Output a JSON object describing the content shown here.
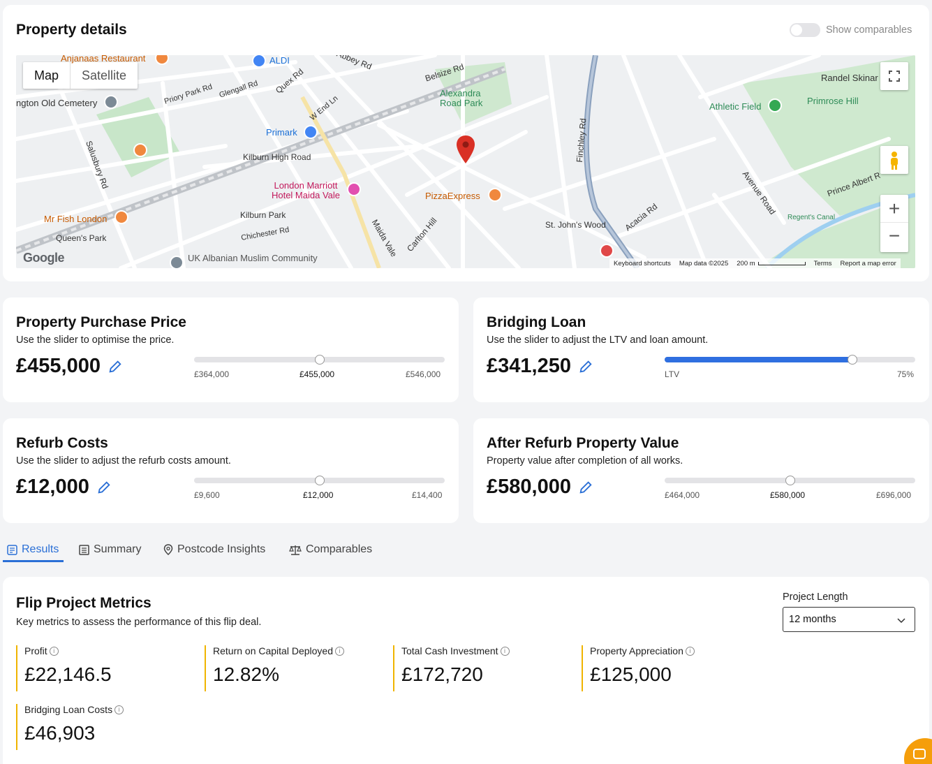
{
  "property": {
    "title": "Property details",
    "show_comparables": "Show comparables",
    "map": {
      "tab_map": "Map",
      "tab_satellite": "Satellite",
      "google": "Google",
      "footer": {
        "keyboard": "Keyboard shortcuts",
        "data": "Map data ©2025",
        "scale": "200 m",
        "terms": "Terms",
        "report": "Report a map error"
      },
      "labels": [
        {
          "text": "Anjanaas Restaurant",
          "color": "#c65a00"
        },
        {
          "text": "ALDI",
          "color": "#1a6fd6"
        },
        {
          "text": "Abbey Rd",
          "color": "#333"
        },
        {
          "text": "Belsize Rd",
          "color": "#333"
        },
        {
          "text": "Alexandra Road Park",
          "color": "#2e8b57"
        },
        {
          "text": "Randel Skinar",
          "color": "#555"
        },
        {
          "text": "Primrose Hill",
          "color": "#2e8b57"
        },
        {
          "text": "Athletic Field",
          "color": "#2e8b57"
        },
        {
          "text": "ngton Old Cemetery",
          "color": "#444"
        },
        {
          "text": "Priory Park Rd",
          "color": "#444"
        },
        {
          "text": "Glengall Rd",
          "color": "#444"
        },
        {
          "text": "Quex Rd",
          "color": "#444"
        },
        {
          "text": "W End Ln",
          "color": "#444"
        },
        {
          "text": "Primark",
          "color": "#1a6fd6"
        },
        {
          "text": "Kilburn High Road",
          "color": "#333"
        },
        {
          "text": "Salusbury Rd",
          "color": "#333"
        },
        {
          "text": "London Marriott Hotel Maida Vale",
          "color": "#c2185b"
        },
        {
          "text": "PizzaExpress",
          "color": "#c65a00"
        },
        {
          "text": "Kilburn Park",
          "color": "#333"
        },
        {
          "text": "Mr Fish London",
          "color": "#c65a00"
        },
        {
          "text": "Queen's Park",
          "color": "#333"
        },
        {
          "text": "Chichester Rd",
          "color": "#444"
        },
        {
          "text": "Maida Vale",
          "color": "#333"
        },
        {
          "text": "Carlton Hill",
          "color": "#333"
        },
        {
          "text": "St. John's Wood",
          "color": "#333"
        },
        {
          "text": "Acacia Rd",
          "color": "#333"
        },
        {
          "text": "Finchley Rd",
          "color": "#333"
        },
        {
          "text": "Avenue Road",
          "color": "#333"
        },
        {
          "text": "Prince Albert R",
          "color": "#333"
        },
        {
          "text": "UK Albanian Muslim Community",
          "color": "#555"
        },
        {
          "text": "Regent's Canal",
          "color": "#2e8b57"
        }
      ]
    }
  },
  "purchase": {
    "title": "Property Purchase Price",
    "subtitle": "Use the slider to optimise the price.",
    "value": "£455,000",
    "min_label": "£364,000",
    "mid_label": "£455,000",
    "max_label": "£546,000",
    "slider_fraction": 0.5
  },
  "bridging": {
    "title": "Bridging Loan",
    "subtitle": "Use the slider to adjust the LTV and loan amount.",
    "value": "£341,250",
    "left_label": "LTV",
    "right_label": "75%",
    "slider_fraction": 0.75
  },
  "refurb": {
    "title": "Refurb Costs",
    "subtitle": "Use the slider to adjust the refurb costs amount.",
    "value": "£12,000",
    "min_label": "£9,600",
    "mid_label": "£12,000",
    "max_label": "£14,400",
    "slider_fraction": 0.5
  },
  "after_refurb": {
    "title": "After Refurb Property Value",
    "subtitle": "Property value after completion of all works.",
    "value": "£580,000",
    "min_label": "£464,000",
    "mid_label": "£580,000",
    "max_label": "£696,000",
    "slider_fraction": 0.5
  },
  "tabs": [
    {
      "label": "Results",
      "icon": "results-icon",
      "active": true
    },
    {
      "label": "Summary",
      "icon": "summary-icon",
      "active": false
    },
    {
      "label": "Postcode Insights",
      "icon": "pin-icon",
      "active": false
    },
    {
      "label": "Comparables",
      "icon": "scales-icon",
      "active": false
    }
  ],
  "metrics": {
    "title": "Flip Project Metrics",
    "subtitle": "Key metrics to assess the performance of this flip deal.",
    "project_length_label": "Project Length",
    "project_length_value": "12 months",
    "items": [
      {
        "label": "Profit",
        "value": "£22,146.5"
      },
      {
        "label": "Return on Capital Deployed",
        "value": "12.82%"
      },
      {
        "label": "Total Cash Investment",
        "value": "£172,720"
      },
      {
        "label": "Property Appreciation",
        "value": "£125,000"
      },
      {
        "label": "Bridging Loan Costs",
        "value": "£46,903"
      }
    ]
  },
  "colors": {
    "accent": "#2f6fe0",
    "metric_border": "#f0b400",
    "chat_bubble": "#f59e0b",
    "marker": "#d93025"
  }
}
